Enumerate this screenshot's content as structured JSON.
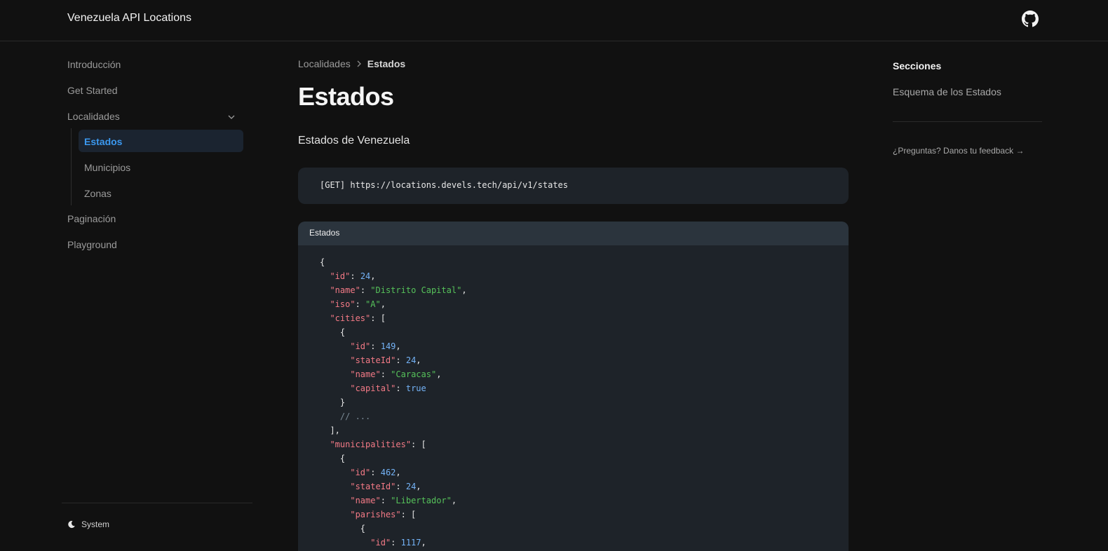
{
  "header": {
    "site_title": "Venezuela API Locations",
    "github_icon": "github-icon"
  },
  "sidebar": {
    "items": [
      {
        "label": "Introducción"
      },
      {
        "label": "Get Started"
      },
      {
        "label": "Localidades",
        "expanded": true,
        "children": [
          {
            "label": "Estados",
            "active": true
          },
          {
            "label": "Municipios"
          },
          {
            "label": "Zonas"
          }
        ]
      },
      {
        "label": "Paginación"
      },
      {
        "label": "Playground"
      }
    ],
    "theme_label": "System",
    "theme_icon": "moon-icon"
  },
  "main": {
    "breadcrumb": {
      "parent": "Localidades",
      "current": "Estados"
    },
    "title": "Estados",
    "lead": "Estados de Venezuela",
    "endpoint": "[GET] https://locations.devels.tech/api/v1/states",
    "code_title": "Estados",
    "code": {
      "state_id": "24",
      "state_name": "\"Distrito Capital\"",
      "state_iso": "\"A\"",
      "city_id": "149",
      "city_state_id": "24",
      "city_name": "\"Caracas\"",
      "city_capital": "true",
      "comment": "// ...",
      "mun_id": "462",
      "mun_state_id": "24",
      "mun_name": "\"Libertador\"",
      "parish_id": "1117"
    }
  },
  "toc": {
    "title": "Secciones",
    "links": [
      {
        "label": "Esquema de los Estados"
      }
    ],
    "feedback": "¿Preguntas? Danos tu feedback →"
  },
  "colors": {
    "background": "#111111",
    "accent": "#3b99f0",
    "code_bg": "#1e2329",
    "key": "#f47a86",
    "string": "#56c25a",
    "number": "#74b3f7"
  }
}
